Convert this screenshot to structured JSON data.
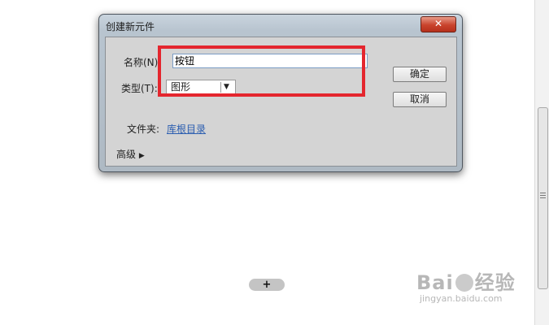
{
  "dialog": {
    "title": "创建新元件",
    "close_glyph": "✕",
    "name_label": "名称(N):",
    "name_value": "按钮",
    "type_label": "类型(T):",
    "type_value": "图形",
    "type_arrow": "▼",
    "folder_label": "文件夹:",
    "folder_link": "库根目录",
    "advanced_label": "高级",
    "advanced_arrow": "▶",
    "ok_label": "确定",
    "cancel_label": "取消"
  },
  "stage": {
    "add_glyph": "+"
  },
  "watermark": {
    "brand": "Bai",
    "brand_suffix": "经验",
    "url": "jingyan.baidu.com"
  },
  "colors": {
    "highlight": "#e4262e",
    "link": "#2a5db0",
    "close": "#c9432c"
  }
}
